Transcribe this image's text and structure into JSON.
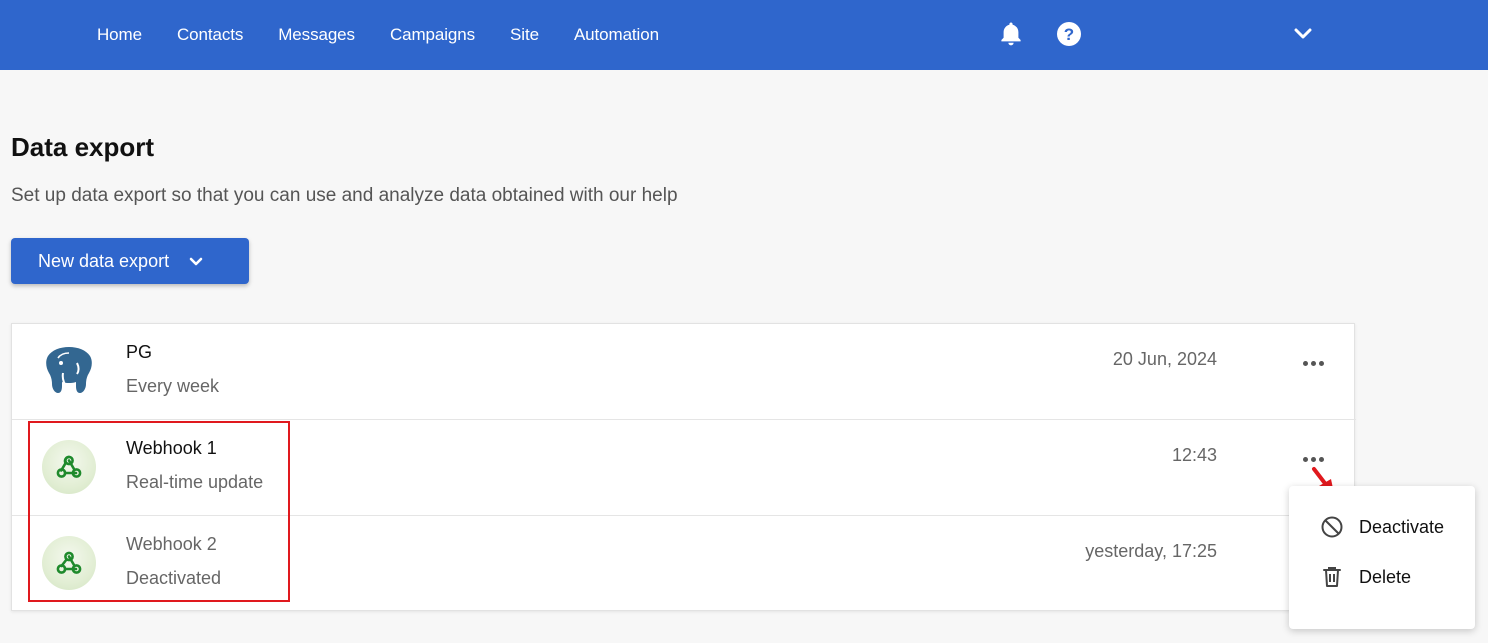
{
  "nav": {
    "items": [
      "Home",
      "Contacts",
      "Messages",
      "Campaigns",
      "Site",
      "Automation"
    ]
  },
  "page": {
    "title": "Data export",
    "subtitle": "Set up data export so that you can use and analyze data obtained with our help"
  },
  "toolbar": {
    "new_export_label": "New data export"
  },
  "exports": [
    {
      "name": "PG",
      "schedule": "Every week",
      "time": "20 Jun, 2024",
      "icon": "postgresql-elephant-icon",
      "active": true
    },
    {
      "name": "Webhook 1",
      "schedule": "Real-time update",
      "time": "12:43",
      "icon": "webhook-icon",
      "active": true
    },
    {
      "name": "Webhook 2",
      "schedule": "Deactivated",
      "time": "yesterday, 17:25",
      "icon": "webhook-icon",
      "active": false
    }
  ],
  "context_menu": {
    "items": [
      {
        "label": "Deactivate",
        "icon": "block-icon"
      },
      {
        "label": "Delete",
        "icon": "trash-icon"
      }
    ]
  },
  "colors": {
    "brand": "#2f66cc",
    "highlight": "#e0191e",
    "webhook_green": "#1f8a2c",
    "postgres_blue": "#336791"
  }
}
